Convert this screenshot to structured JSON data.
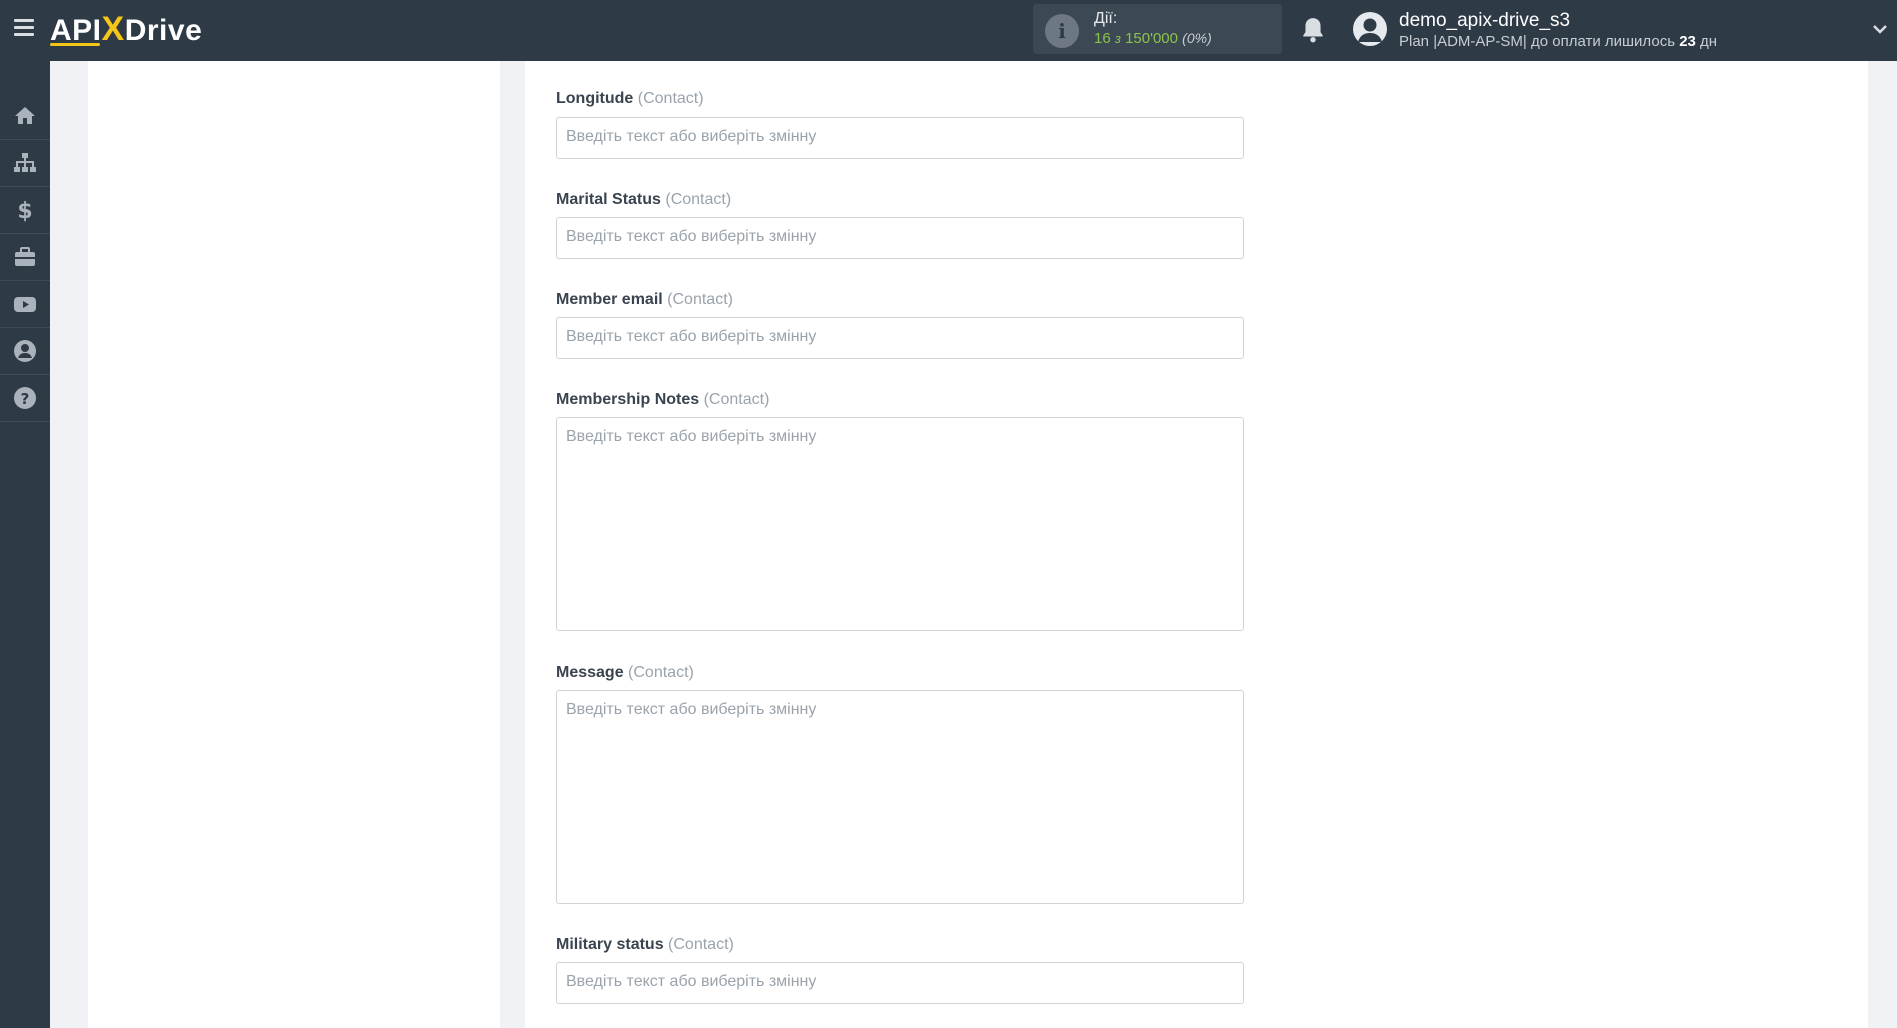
{
  "header": {
    "logo": {
      "part1": "API",
      "part2": "X",
      "part3": "Drive"
    },
    "actions": {
      "label": "Дії:",
      "used": "16",
      "of": "з",
      "total": "150'000",
      "percent": "(0%)"
    },
    "user": {
      "name": "demo_apix-drive_s3",
      "plan_prefix": "Plan |ADM-AP-SM| до оплати лишилось",
      "days": "23",
      "days_suffix": "дн"
    }
  },
  "sidebar": {
    "items": [
      {
        "icon": "home-icon"
      },
      {
        "icon": "sitemap-icon"
      },
      {
        "icon": "dollar-icon"
      },
      {
        "icon": "briefcase-icon"
      },
      {
        "icon": "youtube-icon"
      },
      {
        "icon": "user-circle-icon"
      },
      {
        "icon": "help-icon"
      }
    ]
  },
  "form": {
    "placeholder": "Введіть текст або виберіть змінну",
    "fields": [
      {
        "label": "Longitude",
        "context": "(Contact)",
        "type": "input"
      },
      {
        "label": "Marital Status",
        "context": "(Contact)",
        "type": "input"
      },
      {
        "label": "Member email",
        "context": "(Contact)",
        "type": "input"
      },
      {
        "label": "Membership Notes",
        "context": "(Contact)",
        "type": "textarea"
      },
      {
        "label": "Message",
        "context": "(Contact)",
        "type": "textarea"
      },
      {
        "label": "Military status",
        "context": "(Contact)",
        "type": "input"
      }
    ]
  }
}
